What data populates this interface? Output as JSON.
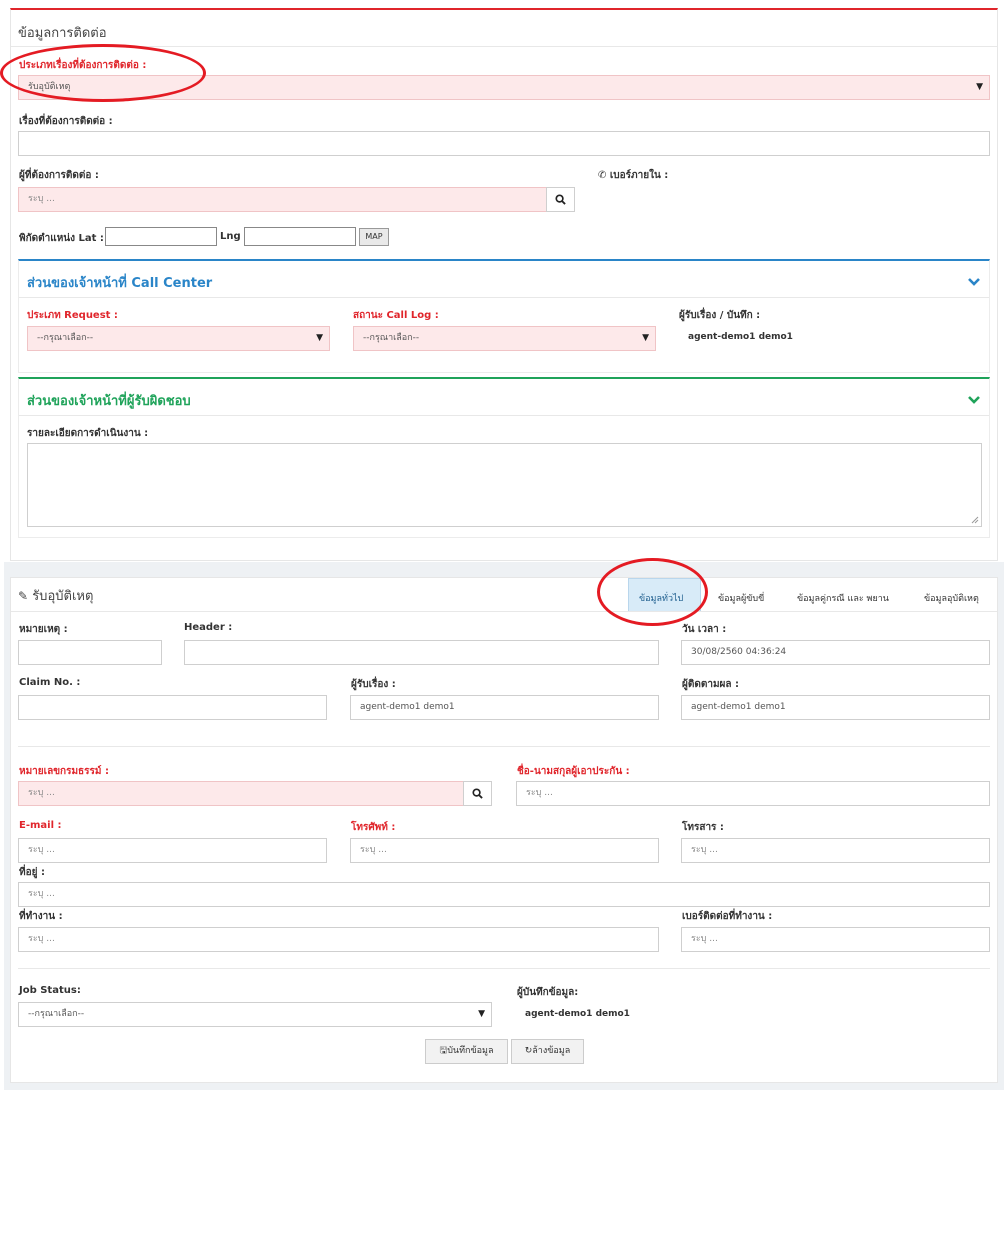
{
  "contact_panel": {
    "title": "ข้อมูลการติดต่อ",
    "type_label": "ประเภทเรื่องที่ต้องการติดต่อ :",
    "type_value": "รับอุบัติเหตุ",
    "subject_label": "เรื่องที่ต้องการติดต่อ :",
    "person_label": "ผู้ที่ต้องการติดต่อ :",
    "person_placeholder": "ระบุ ...",
    "ext_label": "เบอร์ภายใน :",
    "lat_label": "พิกัดตำแหน่ง Lat :",
    "lng_label": "Lng :",
    "map_button": "MAP"
  },
  "call_center": {
    "title": "ส่วนของเจ้าหน้าที่ Call Center",
    "request_label": "ประเภท Request :",
    "request_value": "--กรุณาเลือก--",
    "status_label": "สถานะ Call Log :",
    "status_value": "--กรุณาเลือก--",
    "recorder_label": "ผู้รับเรื่อง / บันทึก :",
    "recorder_value": "agent-demo1 demo1"
  },
  "responsible": {
    "title": "ส่วนของเจ้าหน้าที่ผู้รับผิดชอบ",
    "detail_label": "รายละเอียดการดำเนินงาน :"
  },
  "accident_panel": {
    "title": "รับอุบัติเหตุ",
    "tabs": [
      "ข้อมูลทั่วไป",
      "ข้อมูลผู้ขับขี่",
      "ข้อมูลคู่กรณี และ พยาน",
      "ข้อมูลอุบัติเหตุ"
    ],
    "note_label": "หมายเหตุ :",
    "header_label": "Header :",
    "datetime_label": "วัน เวลา :",
    "datetime_value": "30/08/2560 04:36:24",
    "claim_label": "Claim No. :",
    "receiver_label": "ผู้รับเรื่อง :",
    "receiver_value": "agent-demo1 demo1",
    "follower_label": "ผู้ติดตามผล :",
    "follower_value": "agent-demo1 demo1",
    "policy_label": "หมายเลขกรมธรรม์ :",
    "insured_label": "ชื่อ-นามสกุลผู้เอาประกัน :",
    "email_label": "E-mail :",
    "phone_label": "โทรศัพท์ :",
    "fax_label": "โทรสาร :",
    "address_label": "ที่อยู่ :",
    "workplace_label": "ที่ทำงาน :",
    "work_phone_label": "เบอร์ติดต่อที่ทำงาน :",
    "placeholder": "ระบุ ...",
    "job_status_label": "Job Status:",
    "job_status_value": "--กรุณาเลือก--",
    "saver_label": "ผู้บันทึกข้อมูล:",
    "saver_value": "agent-demo1 demo1",
    "save_button": "บันทึกข้อมูล",
    "clear_button": "ล้างข้อมูล"
  },
  "colors": {
    "accent_red": "#e0252b",
    "call_center_blue": "#2a85c8",
    "responsible_green": "#1fa35a",
    "annotation_red": "#e41b23"
  }
}
